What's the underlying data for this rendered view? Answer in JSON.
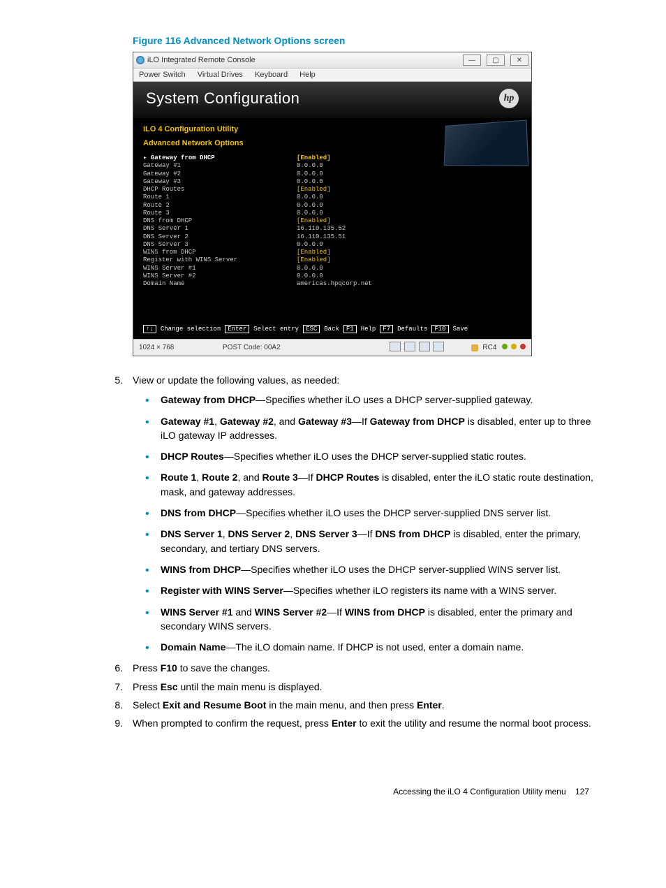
{
  "figure_title": "Figure 116 Advanced Network Options screen",
  "window": {
    "title": "iLO Integrated Remote Console",
    "menu": [
      "Power Switch",
      "Virtual Drives",
      "Keyboard",
      "Help"
    ]
  },
  "header": {
    "title": "System Configuration",
    "logo_text": "hp"
  },
  "config": {
    "utility_title": "iLO 4 Configuration Utility",
    "section_title": "Advanced Network Options",
    "rows": [
      {
        "label": "Gateway from DHCP",
        "value": "[Enabled]",
        "selected": true,
        "enabled": true
      },
      {
        "label": "Gateway #1",
        "value": "0.0.0.0"
      },
      {
        "label": "Gateway #2",
        "value": "0.0.0.0"
      },
      {
        "label": "Gateway #3",
        "value": "0.0.0.0"
      },
      {
        "label": "DHCP Routes",
        "value": "[Enabled]",
        "enabled": true
      },
      {
        "label": "Route 1",
        "value": "0.0.0.0"
      },
      {
        "label": "Route 2",
        "value": "0.0.0.0"
      },
      {
        "label": "Route 3",
        "value": "0.0.0.0"
      },
      {
        "label": "DNS from DHCP",
        "value": "[Enabled]",
        "enabled": true
      },
      {
        "label": "DNS Server 1",
        "value": "16.110.135.52"
      },
      {
        "label": "DNS Server 2",
        "value": "16.110.135.51"
      },
      {
        "label": "DNS Server 3",
        "value": "0.0.0.0"
      },
      {
        "label": "WINS from DHCP",
        "value": "[Enabled]",
        "enabled": true
      },
      {
        "label": "Register with WINS Server",
        "value": "[Enabled]",
        "enabled": true
      },
      {
        "label": "WINS Server #1",
        "value": "0.0.0.0"
      },
      {
        "label": "WINS Server #2",
        "value": "0.0.0.0"
      },
      {
        "label": "Domain Name",
        "value": "americas.hpqcorp.net"
      }
    ],
    "footer_keys": [
      {
        "key": "↑↓",
        "label": "Change selection"
      },
      {
        "key": "Enter",
        "label": "Select entry"
      },
      {
        "key": "ESC",
        "label": "Back"
      },
      {
        "key": "F1",
        "label": "Help"
      },
      {
        "key": "F7",
        "label": "Defaults"
      },
      {
        "key": "F10",
        "label": "Save"
      }
    ]
  },
  "statusbar": {
    "resolution": "1024 × 768",
    "post_code": "POST Code: 00A2",
    "rc": "RC4"
  },
  "doc": {
    "step5_intro": "View or update the following values, as needed:",
    "bullets": [
      [
        [
          "b",
          "Gateway from DHCP"
        ],
        [
          "t",
          "—Specifies whether iLO uses a DHCP server-supplied gateway."
        ]
      ],
      [
        [
          "b",
          "Gateway #1"
        ],
        [
          "t",
          ", "
        ],
        [
          "b",
          "Gateway #2"
        ],
        [
          "t",
          ", and "
        ],
        [
          "b",
          "Gateway #3"
        ],
        [
          "t",
          "—If "
        ],
        [
          "b",
          "Gateway from DHCP"
        ],
        [
          "t",
          " is disabled, enter up to three iLO gateway IP addresses."
        ]
      ],
      [
        [
          "b",
          "DHCP Routes"
        ],
        [
          "t",
          "—Specifies whether iLO uses the DHCP server-supplied static routes."
        ]
      ],
      [
        [
          "b",
          "Route 1"
        ],
        [
          "t",
          ", "
        ],
        [
          "b",
          "Route 2"
        ],
        [
          "t",
          ", and "
        ],
        [
          "b",
          "Route 3"
        ],
        [
          "t",
          "—If "
        ],
        [
          "b",
          "DHCP Routes"
        ],
        [
          "t",
          " is disabled, enter the iLO static route destination, mask, and gateway addresses."
        ]
      ],
      [
        [
          "b",
          "DNS from DHCP"
        ],
        [
          "t",
          "—Specifies whether iLO uses the DHCP server-supplied DNS server list."
        ]
      ],
      [
        [
          "b",
          "DNS Server 1"
        ],
        [
          "t",
          ", "
        ],
        [
          "b",
          "DNS Server 2"
        ],
        [
          "t",
          ", "
        ],
        [
          "b",
          "DNS Server 3"
        ],
        [
          "t",
          "—If "
        ],
        [
          "b",
          "DNS from DHCP"
        ],
        [
          "t",
          " is disabled, enter the primary, secondary, and tertiary DNS servers."
        ]
      ],
      [
        [
          "b",
          "WINS from DHCP"
        ],
        [
          "t",
          "—Specifies whether iLO uses the DHCP server-supplied WINS server list."
        ]
      ],
      [
        [
          "b",
          "Register with WINS Server"
        ],
        [
          "t",
          "—Specifies whether iLO registers its name with a WINS server."
        ]
      ],
      [
        [
          "b",
          "WINS Server #1"
        ],
        [
          "t",
          " and "
        ],
        [
          "b",
          "WINS Server #2"
        ],
        [
          "t",
          "—If "
        ],
        [
          "b",
          "WINS from DHCP"
        ],
        [
          "t",
          " is disabled, enter the primary and secondary WINS servers."
        ]
      ],
      [
        [
          "b",
          "Domain Name"
        ],
        [
          "t",
          "—The iLO domain name. If DHCP is not used, enter a domain name."
        ]
      ]
    ],
    "steps_after": [
      [
        [
          "t",
          "Press "
        ],
        [
          "b",
          "F10"
        ],
        [
          "t",
          " to save the changes."
        ]
      ],
      [
        [
          "t",
          "Press "
        ],
        [
          "b",
          "Esc"
        ],
        [
          "t",
          " until the main menu is displayed."
        ]
      ],
      [
        [
          "t",
          "Select "
        ],
        [
          "b",
          "Exit and Resume Boot"
        ],
        [
          "t",
          " in the main menu, and then press "
        ],
        [
          "b",
          "Enter"
        ],
        [
          "t",
          "."
        ]
      ],
      [
        [
          "t",
          "When prompted to confirm the request, press "
        ],
        [
          "b",
          "Enter"
        ],
        [
          "t",
          " to exit the utility and resume the normal boot process."
        ]
      ]
    ],
    "footer": "Accessing the iLO 4 Configuration Utility menu",
    "page_num": "127"
  }
}
